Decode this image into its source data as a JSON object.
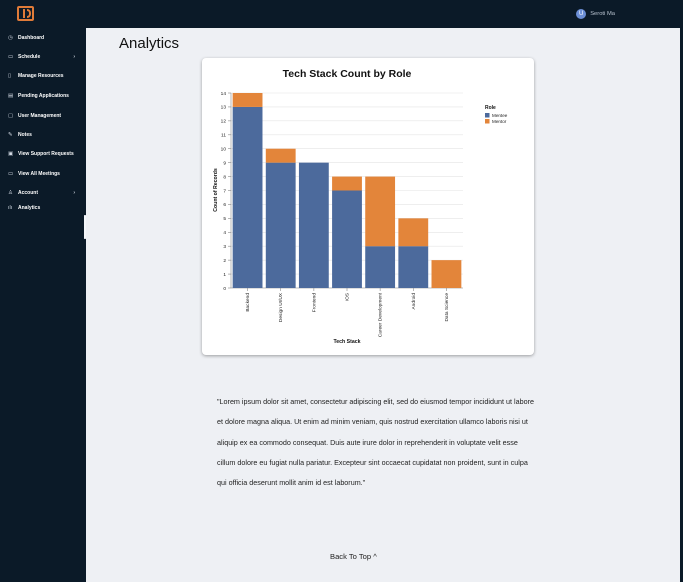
{
  "app": {
    "logo_icon": "ud-logo-icon",
    "user_initial": "U",
    "user_name": "Seroti Ma"
  },
  "sidebar": {
    "items": [
      {
        "label": "Dashboard",
        "icon": "clock-icon",
        "glyph": "◷",
        "chevron": false
      },
      {
        "label": "Schedule",
        "icon": "calendar-icon",
        "glyph": "▭",
        "chevron": true
      },
      {
        "label": "Manage Resources",
        "icon": "document-icon",
        "glyph": "▯",
        "chevron": false
      },
      {
        "label": "Pending Applications",
        "icon": "list-icon",
        "glyph": "▤",
        "chevron": false
      },
      {
        "label": "User Management",
        "icon": "user-card-icon",
        "glyph": "▢",
        "chevron": false
      },
      {
        "label": "Notes",
        "icon": "notes-icon",
        "glyph": "✎",
        "chevron": false
      },
      {
        "label": "View Support Requests",
        "icon": "support-icon",
        "glyph": "▣",
        "chevron": false
      },
      {
        "label": "View All Meetings",
        "icon": "meetings-icon",
        "glyph": "▭",
        "chevron": false
      },
      {
        "label": "Account",
        "icon": "person-icon",
        "glyph": "♙",
        "chevron": true
      },
      {
        "label": "Analytics",
        "icon": "bar-chart-icon",
        "glyph": "ılı",
        "chevron": false
      }
    ],
    "chevron_glyph": "›",
    "collapse_glyph": "‹"
  },
  "main": {
    "title": "Analytics",
    "paragraph": "\"Lorem ipsum dolor sit amet, consectetur adipiscing elit, sed do eiusmod tempor incididunt ut labore et dolore magna aliqua. Ut enim ad minim veniam, quis nostrud exercitation ullamco laboris nisi ut aliquip ex ea commodo consequat. Duis aute irure dolor in reprehenderit in voluptate velit esse cillum dolore eu fugiat nulla pariatur. Excepteur sint occaecat cupidatat non proident, sunt in culpa qui officia deserunt mollit anim id est laborum.\"",
    "back_to_top": "Back To Top ^"
  },
  "chart_data": {
    "type": "bar",
    "stacked": true,
    "title": "Tech Stack Count by Role",
    "xlabel": "Tech Stack",
    "ylabel": "Count of Records",
    "ylim": [
      0,
      14
    ],
    "yticks": [
      0,
      1,
      2,
      3,
      4,
      5,
      6,
      7,
      8,
      9,
      10,
      11,
      12,
      13,
      14
    ],
    "grid": true,
    "legend_title": "Role",
    "legend_placement": "right",
    "categories": [
      "Backend",
      "Design UI/UX",
      "Frontend",
      "iOS",
      "Career Development",
      "Android",
      "Data Science"
    ],
    "series": [
      {
        "name": "Mentee",
        "color": "#4c6a9c",
        "values": [
          13,
          9,
          9,
          7,
          3,
          3,
          0
        ]
      },
      {
        "name": "Mentor",
        "color": "#e3853a",
        "values": [
          1,
          1,
          0,
          1,
          5,
          2,
          2
        ]
      }
    ]
  }
}
